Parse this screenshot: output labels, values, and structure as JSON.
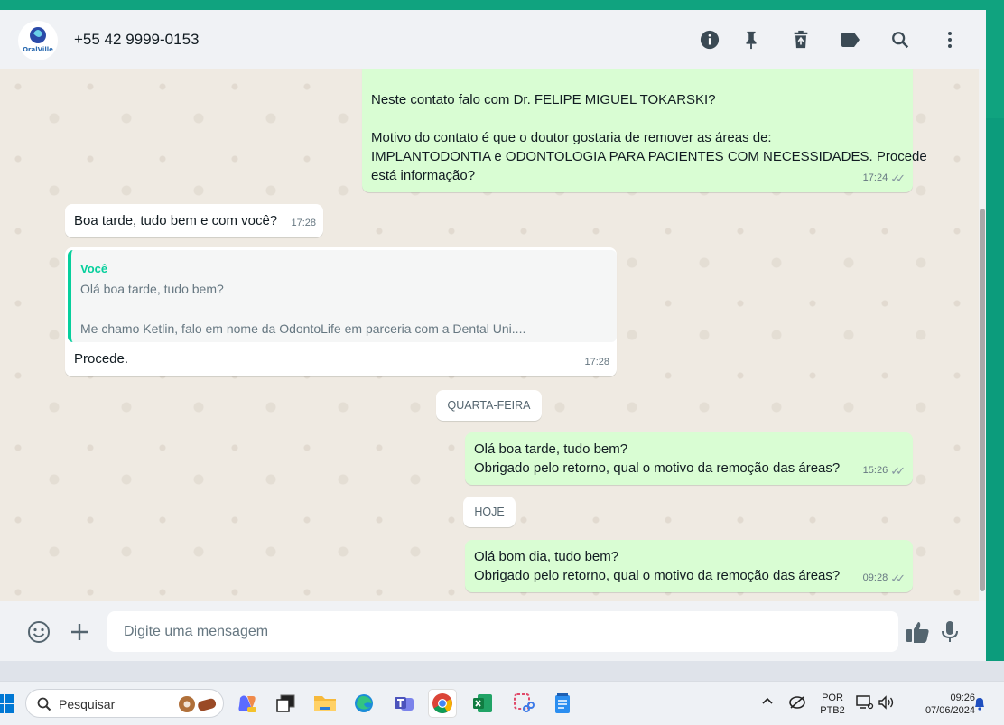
{
  "header": {
    "contact_name": "+55 42 9999-0153",
    "avatar_text": "OralVille",
    "icons": [
      "info-icon",
      "pin-icon",
      "delete-icon",
      "label-icon",
      "search-icon",
      "menu-icon"
    ]
  },
  "messages": {
    "m1": {
      "line1": "Neste contato falo com Dr. FELIPE MIGUEL TOKARSKI?",
      "line2": "Motivo do contato é que o doutor gostaria de remover as áreas de:",
      "line3": "IMPLANTODONTIA e ODONTOLOGIA PARA PACIENTES COM NECESSIDADES. Procede",
      "line4": "está informação?",
      "time": "17:24"
    },
    "m2": {
      "text": "Boa tarde, tudo bem e com você?",
      "time": "17:28"
    },
    "m3": {
      "quote_author": "Você",
      "quote_line1": "Olá boa tarde, tudo bem?",
      "quote_line2": "Me chamo Ketlin, falo em nome da OdontoLife em parceria com a Dental Uni....",
      "text": "Procede.",
      "time": "17:28"
    },
    "day1": "QUARTA-FEIRA",
    "m4": {
      "line1": "Olá boa tarde, tudo bem?",
      "line2": "Obrigado pelo retorno, qual o motivo da remoção das áreas?",
      "time": "15:26"
    },
    "day2": "HOJE",
    "m5": {
      "line1": "Olá bom dia, tudo bem?",
      "line2": "Obrigado pelo retorno, qual o motivo da remoção das áreas?",
      "time": "09:28"
    }
  },
  "composer": {
    "placeholder": "Digite uma mensagem"
  },
  "taskbar": {
    "search_label": "Pesquisar",
    "lang_top": "POR",
    "lang_bottom": "PTB2",
    "time": "09:26",
    "date": "07/06/2024"
  },
  "colors": {
    "accent": "#10a37f",
    "outgoing": "#d9fdd3",
    "incoming": "#ffffff",
    "quote_bar": "#06cf9c"
  }
}
